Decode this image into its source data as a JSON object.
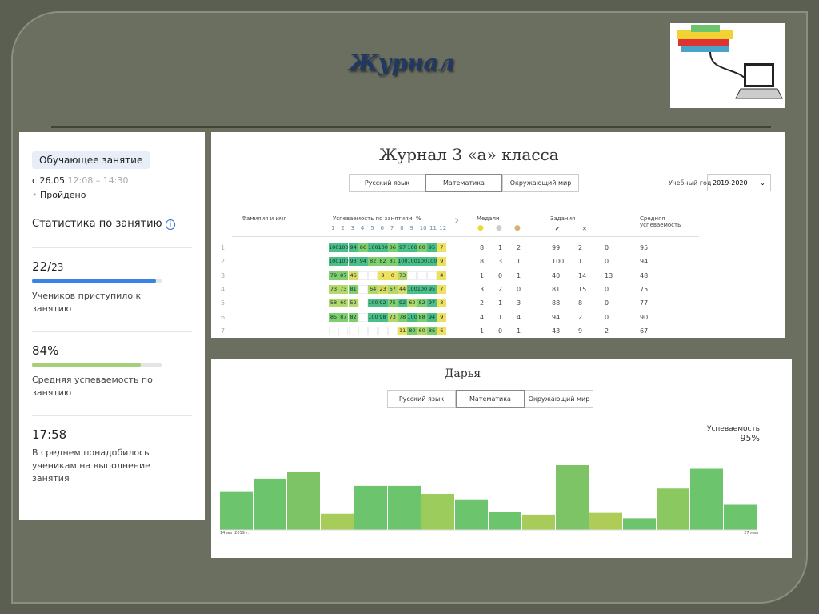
{
  "slide": {
    "title": "Журнал"
  },
  "lesson": {
    "tag": "Обучающее занятие",
    "date": "с 26.05",
    "time_from": "12:08",
    "time_to": "– 14:30",
    "status": "Пройдено",
    "stats_title": "Статистика по занятию",
    "stats": [
      {
        "value": "22/",
        "total": "23",
        "progress": 0.957,
        "color": "#3b82e6",
        "label": "Учеников приступило к занятию"
      },
      {
        "value": "84%",
        "total": "",
        "progress": 0.84,
        "color": "#a5cf7a",
        "label": "Средняя успеваемость по занятию"
      },
      {
        "value": "17:58",
        "total": "",
        "progress": null,
        "color": "",
        "label": "В среднем понадобилось ученикам на выполнение занятия"
      }
    ]
  },
  "journal": {
    "title": "Журнал 3 «а» класса",
    "tabs": [
      "Русский язык",
      "Математика",
      "Окружающий мир"
    ],
    "active_tab": 1,
    "year_label": "Учебный год",
    "year_value": "2019-2020",
    "headers": {
      "name": "Фамилия и имя",
      "progress": "Успеваемость по занятиям, %",
      "medals": "Медали",
      "tasks": "Задания",
      "avg": "Средняя успеваемость",
      "check": "✔",
      "cross": "✕"
    },
    "lesson_numbers": [
      "1",
      "2",
      "3",
      "4",
      "5",
      "6",
      "7",
      "8",
      "9",
      "10",
      "11",
      "12"
    ],
    "rows": [
      {
        "n": "1",
        "scores": [
          100,
          100,
          94,
          86,
          100,
          100,
          86,
          97,
          100,
          80,
          95,
          7
        ],
        "medals": [
          "8",
          "1",
          "2"
        ],
        "tasks": [
          "99",
          "2",
          "0"
        ],
        "avg": "95"
      },
      {
        "n": "2",
        "scores": [
          100,
          100,
          93,
          94,
          82,
          82,
          81,
          100,
          100,
          100,
          100,
          9
        ],
        "medals": [
          "8",
          "3",
          "1"
        ],
        "tasks": [
          "100",
          "1",
          "0"
        ],
        "avg": "94"
      },
      {
        "n": "3",
        "scores": [
          79,
          87,
          46,
          null,
          null,
          8,
          0,
          73,
          null,
          null,
          null,
          4
        ],
        "medals": [
          "1",
          "0",
          "1"
        ],
        "tasks": [
          "40",
          "14",
          "13"
        ],
        "avg": "48"
      },
      {
        "n": "4",
        "scores": [
          73,
          73,
          81,
          null,
          64,
          23,
          67,
          44,
          100,
          100,
          95,
          7
        ],
        "medals": [
          "3",
          "2",
          "0"
        ],
        "tasks": [
          "81",
          "15",
          "0"
        ],
        "avg": "75"
      },
      {
        "n": "5",
        "scores": [
          58,
          60,
          52,
          null,
          100,
          92,
          75,
          92,
          62,
          82,
          97,
          8
        ],
        "medals": [
          "2",
          "1",
          "3"
        ],
        "tasks": [
          "88",
          "8",
          "0"
        ],
        "avg": "77"
      },
      {
        "n": "6",
        "scores": [
          85,
          87,
          82,
          null,
          100,
          98,
          73,
          78,
          100,
          88,
          94,
          9
        ],
        "medals": [
          "4",
          "1",
          "4"
        ],
        "tasks": [
          "94",
          "2",
          "0"
        ],
        "avg": "90"
      },
      {
        "n": "7",
        "scores": [
          null,
          null,
          null,
          null,
          null,
          null,
          null,
          11,
          80,
          60,
          86,
          6
        ],
        "medals": [
          "1",
          "0",
          "1"
        ],
        "tasks": [
          "43",
          "9",
          "2"
        ],
        "avg": "67"
      }
    ]
  },
  "student": {
    "name": "Дарья",
    "tabs": [
      "Русский язык",
      "Математика",
      "Окружающий мир"
    ],
    "active_tab": 1,
    "metric_label": "Успеваемость",
    "metric_value": "95%"
  },
  "chart_data": {
    "type": "bar",
    "x_start_label": "14 авг 2019 г.",
    "x_end_label": "27 мая",
    "values": [
      43,
      57,
      64,
      18,
      49,
      49,
      40,
      34,
      20,
      17,
      72,
      19,
      13,
      46,
      68,
      28
    ],
    "ylim": [
      0,
      80
    ],
    "colors": [
      "#6cc46c",
      "#6cc46c",
      "#7cc466",
      "#a8cc5a",
      "#6cc46c",
      "#6cc46c",
      "#9ccc5c",
      "#6cc46c",
      "#6cc46c",
      "#a8cc5a",
      "#7cc466",
      "#b0cc58",
      "#6cc46c",
      "#8cc860",
      "#6cc46c",
      "#6cc46c"
    ]
  }
}
